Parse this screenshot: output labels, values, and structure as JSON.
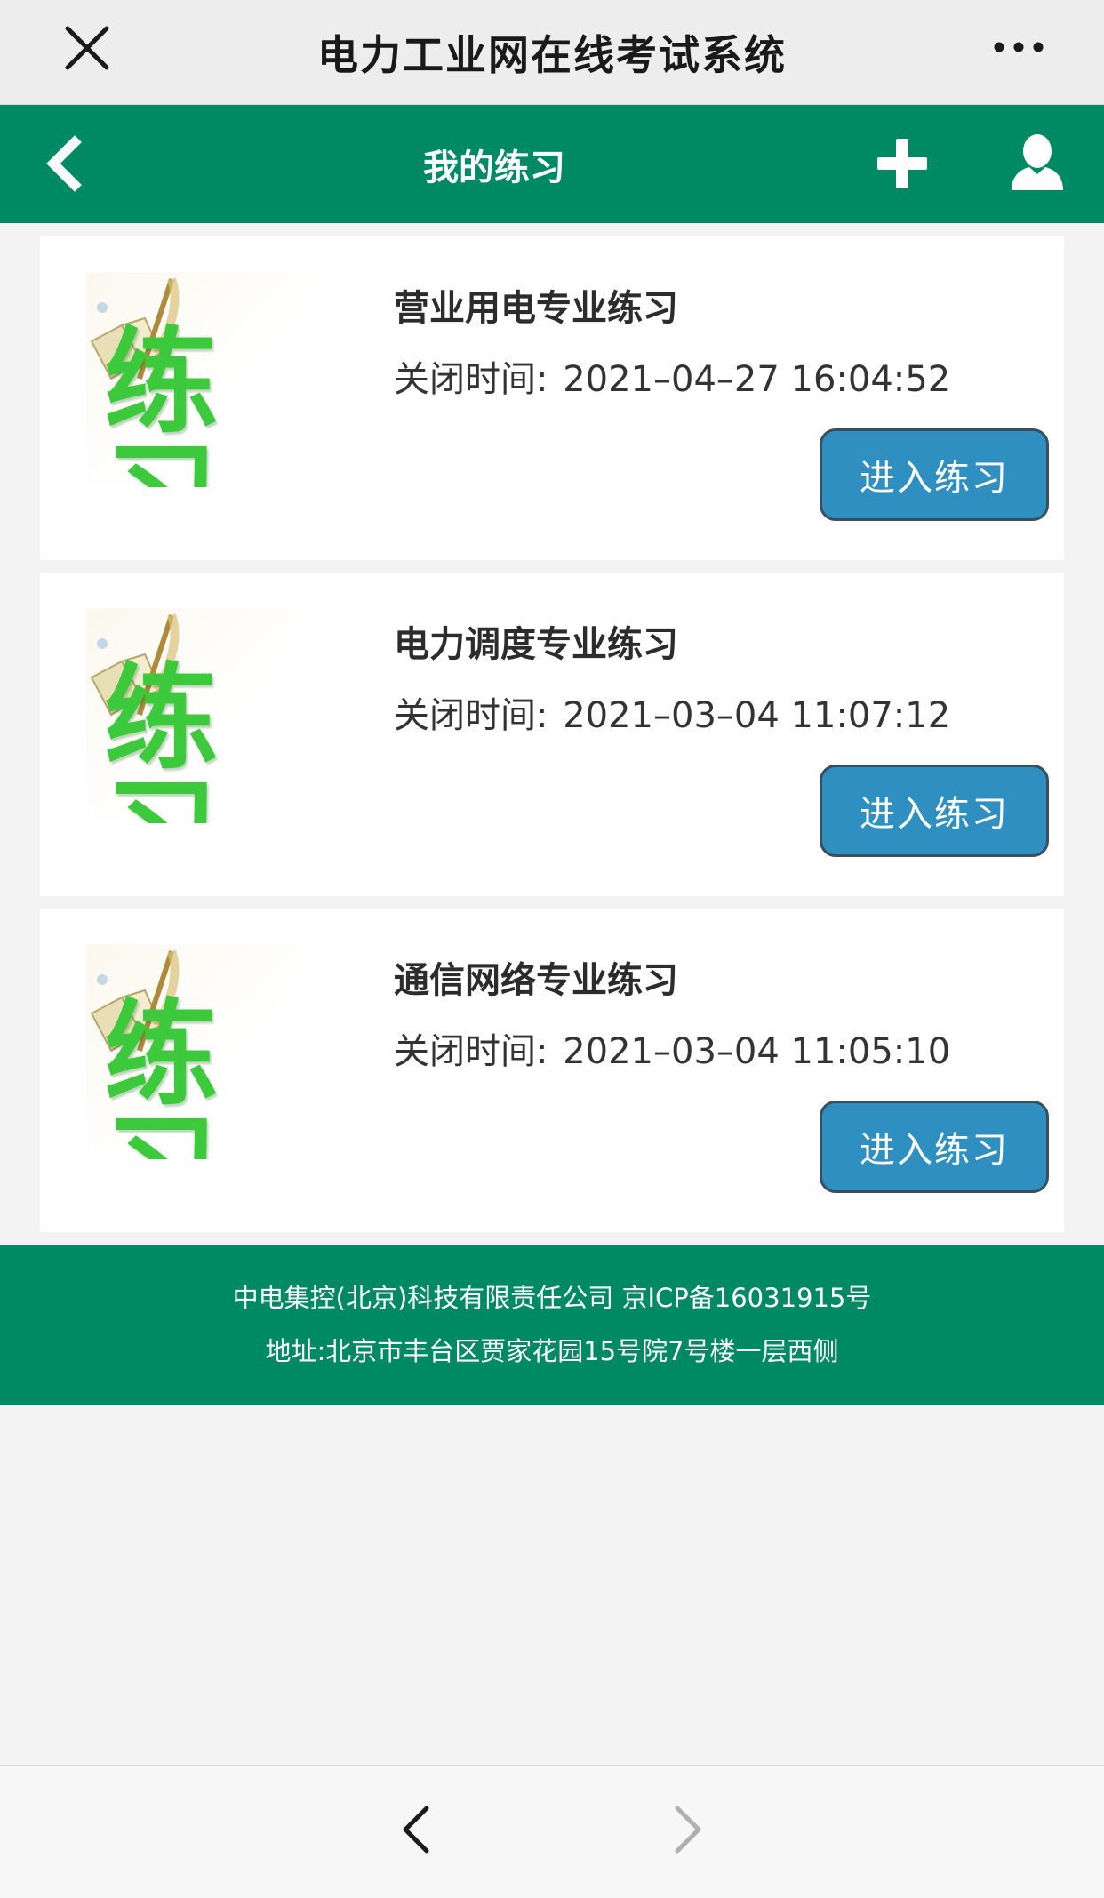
{
  "wechat_bar": {
    "title": "电力工业网在线考试系统",
    "close_icon": "close-icon",
    "more_icon": "more-dots-icon"
  },
  "header": {
    "title": "我的练习",
    "back_icon": "chevron-left-icon",
    "add_icon": "plus-icon",
    "user_icon": "user-icon",
    "color": "#008a64"
  },
  "practices": [
    {
      "thumb_text": "练习",
      "title": "营业用电专业练习",
      "time_label": "关闭时间:",
      "time_value": "2021–04–27 16:04:52",
      "button": "进入练习"
    },
    {
      "thumb_text": "练习",
      "title": "电力调度专业练习",
      "time_label": "关闭时间:",
      "time_value": "2021–03–04 11:07:12",
      "button": "进入练习"
    },
    {
      "thumb_text": "练习",
      "title": "通信网络专业练习",
      "time_label": "关闭时间:",
      "time_value": "2021–03–04 11:05:10",
      "button": "进入练习"
    }
  ],
  "footer": {
    "line1": "中电集控(北京)科技有限责任公司 京ICP备16031915号",
    "line2": "地址:北京市丰台区贾家花园15号院7号楼一层西侧"
  },
  "browser_nav": {
    "back_icon": "chevron-left-icon",
    "forward_icon": "chevron-right-icon"
  },
  "colors": {
    "brand_green": "#008a64",
    "button_blue": "#2f8fc0",
    "thumb_green": "#3cc93c"
  }
}
